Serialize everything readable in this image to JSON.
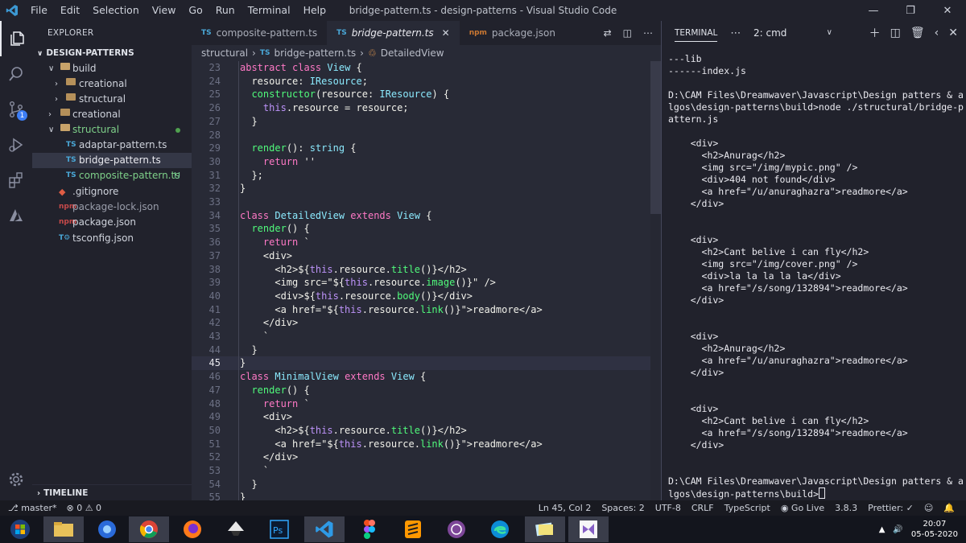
{
  "window": {
    "title": "bridge-pattern.ts - design-patterns - Visual Studio Code",
    "menu": [
      "File",
      "Edit",
      "Selection",
      "View",
      "Go",
      "Run",
      "Terminal",
      "Help"
    ]
  },
  "activity_bar": {
    "items": [
      "explorer-icon",
      "search-icon",
      "source-control-icon",
      "run-debug-icon",
      "extensions-icon",
      "azure-icon"
    ],
    "scm_badge": "1",
    "settings": "gear-icon"
  },
  "sidebar": {
    "header": "EXPLORER",
    "section": "DESIGN-PATTERNS",
    "tree": [
      {
        "label": "build",
        "type": "folder",
        "open": true,
        "depth": 0
      },
      {
        "label": "creational",
        "type": "folder",
        "open": false,
        "depth": 1
      },
      {
        "label": "structural",
        "type": "folder",
        "open": false,
        "depth": 1
      },
      {
        "label": "creational",
        "type": "folder",
        "open": false,
        "depth": 0
      },
      {
        "label": "structural",
        "type": "folder",
        "open": true,
        "depth": 0,
        "modified": true
      },
      {
        "label": "adaptar-pattern.ts",
        "type": "ts",
        "depth": 1
      },
      {
        "label": "bridge-pattern.ts",
        "type": "ts",
        "depth": 1,
        "selected": true
      },
      {
        "label": "composite-pattern.ts",
        "type": "ts",
        "depth": 1,
        "status": "U"
      },
      {
        "label": ".gitignore",
        "type": "git",
        "depth": 0
      },
      {
        "label": "package-lock.json",
        "type": "json",
        "depth": 0
      },
      {
        "label": "package.json",
        "type": "json",
        "depth": 0
      },
      {
        "label": "tsconfig.json",
        "type": "tsconfig",
        "depth": 0
      }
    ],
    "timeline": "TIMELINE"
  },
  "tabs": [
    {
      "label": "composite-pattern.ts",
      "icon": "TS",
      "active": false
    },
    {
      "label": "bridge-pattern.ts",
      "icon": "TS",
      "active": true
    },
    {
      "label": "package.json",
      "icon": "{}",
      "active": false
    }
  ],
  "breadcrumb": {
    "folder": "structural",
    "file": "bridge-pattern.ts",
    "symbol": "DetailedView",
    "file_icon": "TS"
  },
  "code": {
    "current_line": 45,
    "lines": [
      {
        "n": "23",
        "t": "abstract class View {"
      },
      {
        "n": "24",
        "t": "  resource: IResource;"
      },
      {
        "n": "25",
        "t": "  constructor(resource: IResource) {"
      },
      {
        "n": "26",
        "t": "    this.resource = resource;"
      },
      {
        "n": "27",
        "t": "  }"
      },
      {
        "n": "28",
        "t": ""
      },
      {
        "n": "29",
        "t": "  render(): string {"
      },
      {
        "n": "30",
        "t": "    return ''"
      },
      {
        "n": "31",
        "t": "  };"
      },
      {
        "n": "32",
        "t": "}"
      },
      {
        "n": "33",
        "t": ""
      },
      {
        "n": "34",
        "t": "class DetailedView extends View {"
      },
      {
        "n": "35",
        "t": "  render() {"
      },
      {
        "n": "36",
        "t": "    return `"
      },
      {
        "n": "37",
        "t": "    <div>"
      },
      {
        "n": "38",
        "t": "      <h2>${this.resource.title()}</h2>"
      },
      {
        "n": "39",
        "t": "      <img src=\"${this.resource.image()}\" />"
      },
      {
        "n": "40",
        "t": "      <div>${this.resource.body()}</div>"
      },
      {
        "n": "41",
        "t": "      <a href=\"${this.resource.link()}\">readmore</a>"
      },
      {
        "n": "42",
        "t": "    </div>"
      },
      {
        "n": "43",
        "t": "    `"
      },
      {
        "n": "44",
        "t": "  }"
      },
      {
        "n": "45",
        "t": "}"
      },
      {
        "n": "46",
        "t": "class MinimalView extends View {"
      },
      {
        "n": "47",
        "t": "  render() {"
      },
      {
        "n": "48",
        "t": "    return `"
      },
      {
        "n": "49",
        "t": "    <div>"
      },
      {
        "n": "50",
        "t": "      <h2>${this.resource.title()}</h2>"
      },
      {
        "n": "51",
        "t": "      <a href=\"${this.resource.link()}\">readmore</a>"
      },
      {
        "n": "52",
        "t": "    </div>"
      },
      {
        "n": "53",
        "t": "    `"
      },
      {
        "n": "54",
        "t": "  }"
      },
      {
        "n": "55",
        "t": "}"
      }
    ]
  },
  "terminal": {
    "tab": "TERMINAL",
    "shell": "2: cmd",
    "lines": [
      "---lib",
      "------index.js",
      "",
      "D:\\CAM Files\\Dreamwaver\\Javascript\\Design patters & a",
      "lgos\\design-patterns\\build>node ./structural/bridge-p",
      "attern.js",
      "",
      "    <div>",
      "      <h2>Anurag</h2>",
      "      <img src=\"/img/mypic.png\" />",
      "      <div>404 not found</div>",
      "      <a href=\"/u/anuraghazra\">readmore</a>",
      "    </div>",
      "",
      "",
      "    <div>",
      "      <h2>Cant belive i can fly</h2>",
      "      <img src=\"/img/cover.png\" />",
      "      <div>la la la la la</div>",
      "      <a href=\"/s/song/132894\">readmore</a>",
      "    </div>",
      "",
      "",
      "    <div>",
      "      <h2>Anurag</h2>",
      "      <a href=\"/u/anuraghazra\">readmore</a>",
      "    </div>",
      "",
      "",
      "    <div>",
      "      <h2>Cant belive i can fly</h2>",
      "      <a href=\"/s/song/132894\">readmore</a>",
      "    </div>",
      "",
      "",
      "D:\\CAM Files\\Dreamwaver\\Javascript\\Design patters & a",
      "lgos\\design-patterns\\build>"
    ]
  },
  "statusbar": {
    "branch": "master*",
    "problems": "⊗ 0 ⚠ 0",
    "position": "Ln 45, Col 2",
    "spaces": "Spaces: 2",
    "encoding": "UTF-8",
    "eol": "CRLF",
    "language": "TypeScript",
    "golive": "Go Live",
    "ts_version": "3.8.3",
    "prettier": "Prettier: ✓"
  },
  "taskbar": {
    "apps": [
      "start",
      "file-explorer",
      "firefox-dev",
      "chrome",
      "firefox",
      "inkscape",
      "photoshop",
      "vscode",
      "figma",
      "sublime",
      "tor",
      "edge",
      "gallery",
      "visual-studio"
    ],
    "time": "20:07",
    "date": "05-05-2020"
  },
  "colors": {
    "accent": "#bd93f9",
    "background": "#282a36",
    "sidebar": "#21222c"
  }
}
